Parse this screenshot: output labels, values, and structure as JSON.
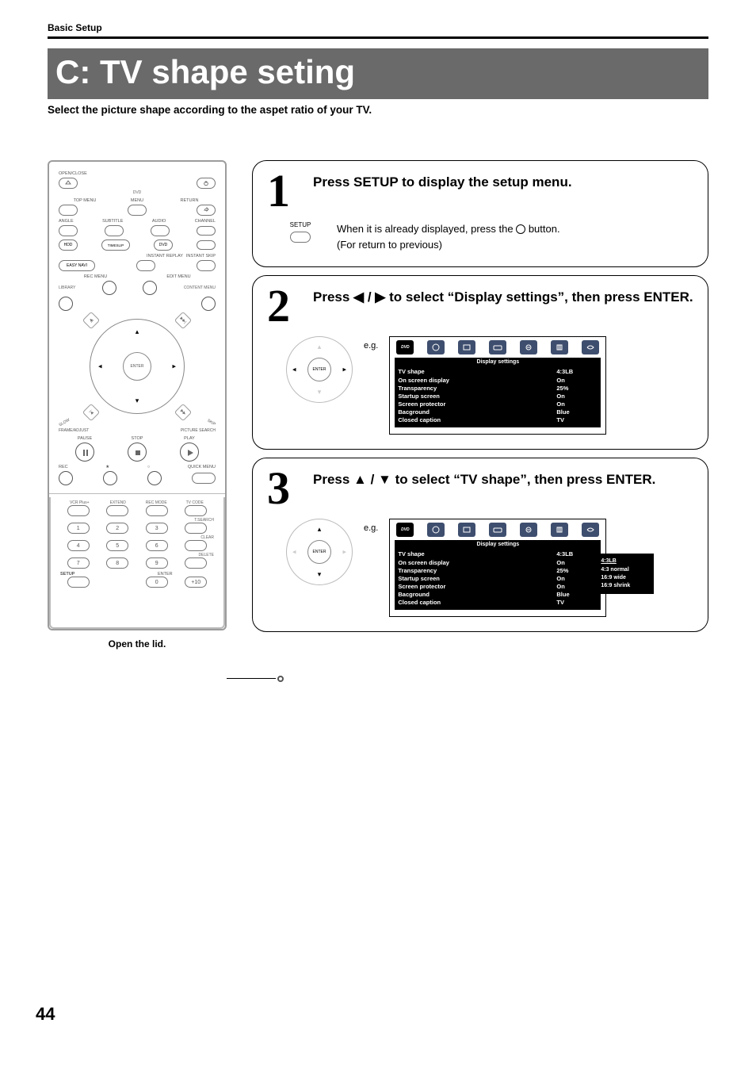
{
  "section": "Basic Setup",
  "title": "C: TV shape seting",
  "lead": "Select the picture shape according to the aspet ratio of your TV.",
  "page_number": "44",
  "remote": {
    "open_close": "OPEN/CLOSE",
    "dvd": "DVD",
    "top_menu": "TOP MENU",
    "menu": "MENU",
    "return": "RETURN",
    "angle": "ANGLE",
    "subtitle": "SUBTITLE",
    "audio": "AUDIO",
    "channel": "CHANNEL",
    "hdd": "HDD",
    "timeslip": "TIMESLIP",
    "dvd2": "DVD",
    "instant_replay": "INSTANT REPLAY",
    "instant_skip": "INSTANT SKIP",
    "easy_navi": "EASY NAVI",
    "rec_menu": "REC MENU",
    "edit_menu": "EDIT MENU",
    "library": "LIBRARY",
    "content_menu": "CONTENT MENU",
    "slow": "SLOW",
    "skip": "SKIP",
    "enter": "ENTER",
    "frame_adjust": "FRAME/ADJUST",
    "picture_search": "PICTURE SEARCH",
    "pause": "PAUSE",
    "stop": "STOP",
    "play": "PLAY",
    "rec": "REC",
    "quick_menu": "QUICK MENU",
    "vcrplus": "VCR Plus+",
    "extend": "EXTEND",
    "rec_mode": "REC MODE",
    "tv_code": "TV CODE",
    "tsearch": "T.SEARCH",
    "clear": "CLEAR",
    "delete": "DELETE",
    "setup": "SETUP",
    "enter2": "ENTER",
    "plus10": "+10",
    "n0": "0",
    "n1": "1",
    "n2": "2",
    "n3": "3",
    "n4": "4",
    "n5": "5",
    "n6": "6",
    "n7": "7",
    "n8": "8",
    "n9": "9",
    "open_lid": "Open the lid."
  },
  "steps": [
    {
      "num": "1",
      "title": "Press SETUP to display the setup menu.",
      "setup_label": "SETUP",
      "line1": "When it is already displayed, press the",
      "line1_suffix": "button.",
      "line2": "(For return to previous)"
    },
    {
      "num": "2",
      "title_pre": "Press ",
      "title_mid": " to select “Display settings”, then press ENTER.",
      "eg": "e.g.",
      "enter": "ENTER",
      "osd_title": "Display settings",
      "rows": [
        {
          "k": "TV shape",
          "v": "4:3LB"
        },
        {
          "k": "On screen display",
          "v": "On"
        },
        {
          "k": "Transparency",
          "v": "25%"
        },
        {
          "k": "Startup screen",
          "v": "On"
        },
        {
          "k": "Screen protector",
          "v": "On"
        },
        {
          "k": "Bacground",
          "v": "Blue"
        },
        {
          "k": "Closed caption",
          "v": "TV"
        }
      ]
    },
    {
      "num": "3",
      "title_pre": "Press ",
      "title_mid": " to select “TV shape”, then press ENTER.",
      "eg": "e.g.",
      "enter": "ENTER",
      "osd_title": "Display settings",
      "rows": [
        {
          "k": "TV shape",
          "v": "4:3LB"
        },
        {
          "k": "On screen display",
          "v": "On"
        },
        {
          "k": "Transparency",
          "v": "25%"
        },
        {
          "k": "Startup screen",
          "v": "On"
        },
        {
          "k": "Screen protector",
          "v": "On"
        },
        {
          "k": "Bacground",
          "v": "Blue"
        },
        {
          "k": "Closed caption",
          "v": "TV"
        }
      ],
      "popup": [
        "4:3LB",
        "4:3 normal",
        "16:9 wide",
        "16:9 shrink"
      ]
    }
  ]
}
